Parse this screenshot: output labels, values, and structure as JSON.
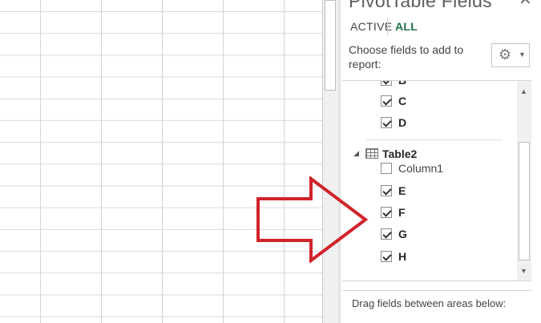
{
  "pane": {
    "title": "PivotTable Fields",
    "close_glyph": "✕",
    "tabs": [
      {
        "label": "ACTIVE",
        "selected": false
      },
      {
        "label": "ALL",
        "selected": true
      }
    ],
    "choose_text": "Choose fields to add to report:",
    "gear_icon": "gear-icon",
    "accent_color": "#217346",
    "fields": [
      {
        "label": "B",
        "checked": true
      },
      {
        "label": "C",
        "checked": true
      },
      {
        "label": "D",
        "checked": true
      }
    ],
    "table2": {
      "label": "Table2",
      "expander": "◢",
      "fields": [
        {
          "label": "Column1",
          "checked": false
        },
        {
          "label": "E",
          "checked": true
        },
        {
          "label": "F",
          "checked": true
        },
        {
          "label": "G",
          "checked": true
        },
        {
          "label": "H",
          "checked": true
        }
      ]
    },
    "drag_text": "Drag fields between areas below:"
  },
  "annotation": {
    "color": "#d0232a",
    "direction": "right"
  }
}
